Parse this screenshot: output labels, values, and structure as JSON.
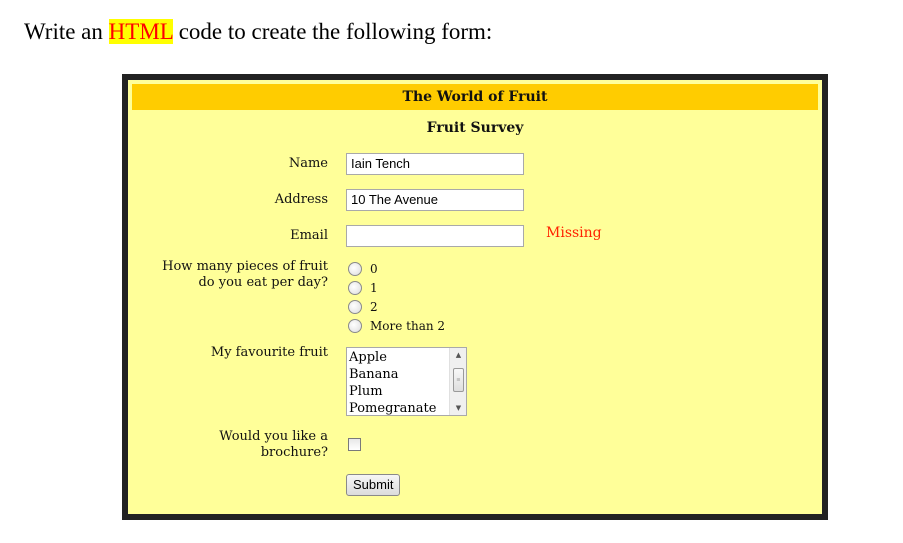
{
  "intro": {
    "before": "Write an ",
    "highlight": "HTML",
    "after": " code to create the following form:"
  },
  "form": {
    "banner_title": "The World of Fruit",
    "subtitle": "Fruit Survey",
    "name": {
      "label": "Name",
      "value": "Iain Tench"
    },
    "address": {
      "label": "Address",
      "value": "10 The Avenue"
    },
    "email": {
      "label": "Email",
      "value": "",
      "error": "Missing"
    },
    "pieces": {
      "label_line1": "How many pieces of fruit",
      "label_line2": "do you eat per day?",
      "options": [
        "0",
        "1",
        "2",
        "More than 2"
      ]
    },
    "favourite": {
      "label": "My favourite fruit",
      "options": [
        "Apple",
        "Banana",
        "Plum",
        "Pomegranate"
      ]
    },
    "brochure": {
      "label_line1": "Would you like a",
      "label_line2": "brochure?",
      "checked": false
    },
    "submit_label": "Submit"
  },
  "colors": {
    "banner": "#ffcc00",
    "panel": "#ffff99",
    "frame": "#222222",
    "error": "#ff2200",
    "highlight_bg": "#ffff00",
    "highlight_text": "#ff0000"
  }
}
